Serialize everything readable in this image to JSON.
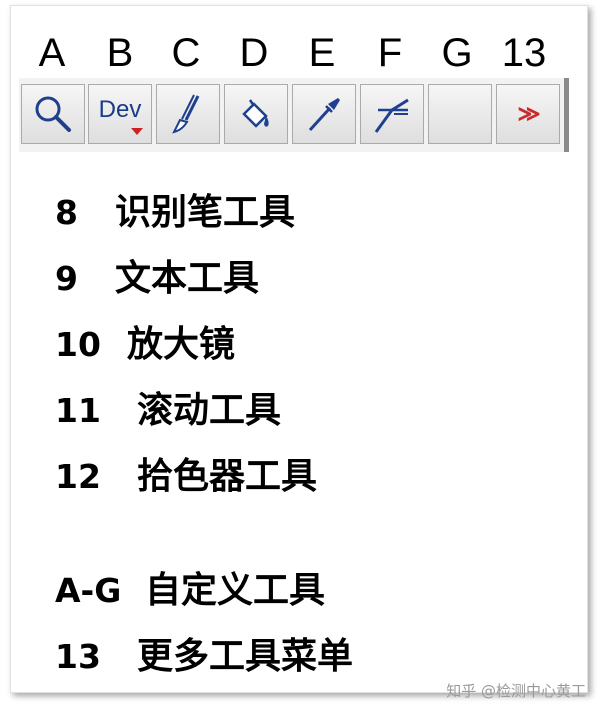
{
  "toolbar": {
    "column_labels": [
      "A",
      "B",
      "C",
      "D",
      "E",
      "F",
      "G",
      "13"
    ],
    "buttons": [
      {
        "name": "magnifier-button",
        "icon": "magnifier-icon"
      },
      {
        "name": "dev-dropdown-button",
        "label": "Dev",
        "icon": "dropdown-arrow-icon"
      },
      {
        "name": "brush-button",
        "icon": "brush-icon"
      },
      {
        "name": "paint-bucket-button",
        "icon": "paint-bucket-icon"
      },
      {
        "name": "eyedropper-button",
        "icon": "eyedropper-icon"
      },
      {
        "name": "line-tool-button",
        "icon": "line-tool-icon"
      },
      {
        "name": "empty-custom-button",
        "icon": ""
      },
      {
        "name": "more-tools-button",
        "label": "≫",
        "icon": "double-chevron-icon"
      }
    ]
  },
  "legend": [
    {
      "key": "8",
      "text": "识别笔工具"
    },
    {
      "key": "9",
      "text": "文本工具"
    },
    {
      "key": "10",
      "text": "放大镜"
    },
    {
      "key": "11",
      "text": "滚动工具"
    },
    {
      "key": "12",
      "text": "拾色器工具"
    },
    {
      "key": "A-G",
      "text": "自定义工具"
    },
    {
      "key": "13",
      "text": "更多工具菜单"
    }
  ],
  "watermark": "知乎 @检测中心黄工",
  "colors": {
    "dev_text": "#1a3a8a",
    "accent_red": "#cc2a2a",
    "icon_blue": "#1f3f8f"
  }
}
